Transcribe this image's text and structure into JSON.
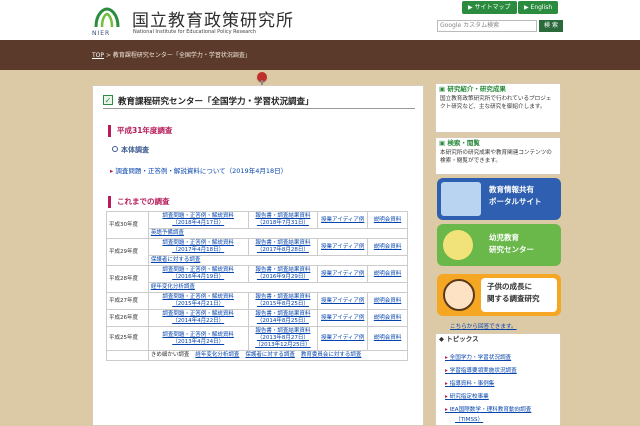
{
  "header": {
    "logo_title": "国立教育政策研究所",
    "logo_subtitle": "National Institute for Educational Policy Research",
    "logo_abbr": "NIER",
    "sitemap_label": "サイトマップ",
    "english_label": "English",
    "search_placeholder": "Google カスタム検索",
    "search_button": "検 索"
  },
  "breadcrumb": {
    "top": "TOP",
    "current": " > 教育課程研究センター「全国学力・学習状況調査」"
  },
  "main": {
    "page_title": "教育課程研究センター「全国学力・学習状況調査」",
    "section_current": "平成31年度調査",
    "subsection": "本体調査",
    "current_link": "調査問題・正答例・解説資料について（2019年4月18日）",
    "section_past": "これまでの調査",
    "rows": [
      {
        "year": "平成30年度",
        "c1": [
          "調査問題・正答例・解説資料",
          "（2018年4月17日）"
        ],
        "c2": [
          "報告書・調査結果資料",
          "（2018年7月31日）"
        ],
        "c3": "授業アイディア例",
        "c4": "説明会資料",
        "extra": "英語予備調査"
      },
      {
        "year": "平成29年度",
        "c1": [
          "調査問題・正答例・解説資料",
          "（2017年4月18日）"
        ],
        "c2": [
          "報告書・調査結果資料",
          "（2017年8月28日）"
        ],
        "c3": "授業アイディア例",
        "c4": "説明会資料",
        "extra": "保護者に対する調査"
      },
      {
        "year": "平成28年度",
        "c1": [
          "調査問題・正答例・解説資料",
          "（2016年4月19日）"
        ],
        "c2": [
          "報告書・調査結果資料",
          "（2016年9月29日）"
        ],
        "c3": "授業アイディア例",
        "c4": "説明会資料",
        "extra": "経年変化分析調査"
      },
      {
        "year": "平成27年度",
        "c1": [
          "調査問題・正答例・解説資料",
          "（2015年4月21日）"
        ],
        "c2": [
          "報告書・調査結果資料",
          "（2015年8月25日）"
        ],
        "c3": "授業アイディア例",
        "c4": "説明会資料",
        "extra": ""
      },
      {
        "year": "平成26年度",
        "c1": [
          "調査問題・正答例・解説資料",
          "（2014年4月22日）"
        ],
        "c2": [
          "報告書・調査結果資料",
          "（2014年8月25日）"
        ],
        "c3": "授業アイディア例",
        "c4": "説明会資料",
        "extra": ""
      },
      {
        "year": "平成25年度",
        "c1": [
          "調査問題・正答例・解説資料",
          "（2013年4月24日）"
        ],
        "c2": [
          "報告書・調査結果資料",
          "（2013年8月27日）",
          "（2013年12月25日）"
        ],
        "c3": "授業アイディア例",
        "c4": "説明会資料",
        "extra": ""
      }
    ],
    "last_row": [
      "きめ細かい調査",
      "経年変化分析調査",
      "保護者に対する調査",
      "教育委員会に対する調査"
    ]
  },
  "sidebar": {
    "research_head": "研究紹介・研究成果",
    "research_body": "国立教育政策研究所で行われているプロジェクト研究など、主な研究を御紹介します。",
    "search_head": "検索・閲覧",
    "search_body": "本研究所の研究成果や教育関連コンテンツの検索・閲覧ができます。",
    "banner1": [
      "教育情報共有",
      "ポータルサイト"
    ],
    "banner2": [
      "幼児教育",
      "研究センター"
    ],
    "banner3": [
      "子供の成長に",
      "関する調査研究"
    ],
    "banner3_link": "こちらから回答できます。",
    "topics_head": "トピックス",
    "topics": [
      "全国学力・学習状況調査",
      "学習指導要領実施状況調査",
      "指導資料・事例集",
      "研究指定校事業",
      "IEA国際数学・理科教育動向調査",
      "（TIMSS）"
    ]
  },
  "colors": {
    "brand_green": "#2b8b3e",
    "accent_magenta": "#b71c5a",
    "crumb_brown": "#5b3a2c"
  }
}
